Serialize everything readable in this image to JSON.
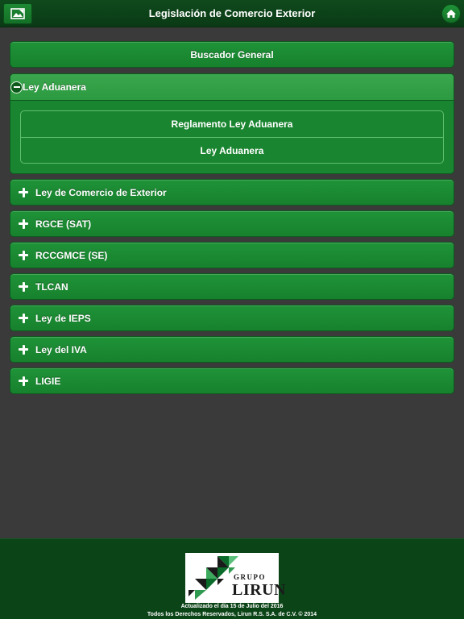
{
  "header": {
    "title": "Legislación de Comercio Exterior",
    "left_button_icon": "image-gallery-icon",
    "right_button_icon": "home-icon"
  },
  "menu": {
    "search_label": "Buscador General",
    "expanded_section": {
      "label": "Ley Aduanera",
      "items": [
        "Reglamento Ley Aduanera",
        "Ley Aduanera"
      ]
    },
    "sections": [
      "Ley de Comercio de Exterior",
      "RGCE (SAT)",
      "RCCGMCE (SE)",
      "TLCAN",
      "Ley de IEPS",
      "Ley del IVA",
      "LIGIE"
    ]
  },
  "footer": {
    "logo_top": "GRUPO",
    "logo_name": "LIRUN",
    "updated": "Actualizado el día 15 de Julio del 2016",
    "copyright": "Todos los Derechos Reservados, Lirun R.S. S.A. de C.V. © 2014"
  },
  "colors": {
    "bar_green": "#1f9338",
    "header_green": "#0f4a1c",
    "background": "#3a3a3a"
  }
}
